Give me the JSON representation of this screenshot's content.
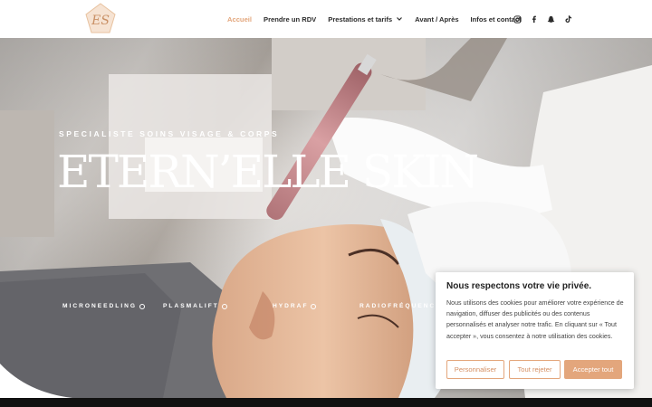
{
  "brand": {
    "logo_letters": "ES"
  },
  "nav": {
    "items": [
      {
        "label": "Accueil"
      },
      {
        "label": "Prendre un RDV"
      },
      {
        "label": "Prestations et tarifs"
      },
      {
        "label": "Avant / Après"
      },
      {
        "label": "Infos et contact"
      }
    ],
    "social_icons": [
      "instagram-icon",
      "facebook-icon",
      "snapchat-icon",
      "tiktok-icon"
    ]
  },
  "hero": {
    "kicker": "SPECIALISTE SOINS VISAGE & CORPS",
    "title": "ETERN’ELLE SKIN",
    "services": [
      "MICRONEEDLING",
      "PLASMALIFT",
      "HYDRAF",
      "RADIOFRÉQUENCE"
    ]
  },
  "cookie": {
    "title": "Nous respectons votre vie privée.",
    "text": "Nous utilisons des cookies pour améliorer votre expérience de navigation, diffuser des publicités ou des contenus personnalisés et analyser notre trafic. En cliquant sur « Tout accepter », vous consentez à notre utilisation des cookies.",
    "buttons": {
      "customize": "Personnaliser",
      "reject": "Tout rejeter",
      "accept": "Accepter tout"
    }
  },
  "colors": {
    "accent": "#e3a67c",
    "nav_text": "#2b2b2b",
    "white": "#ffffff"
  }
}
